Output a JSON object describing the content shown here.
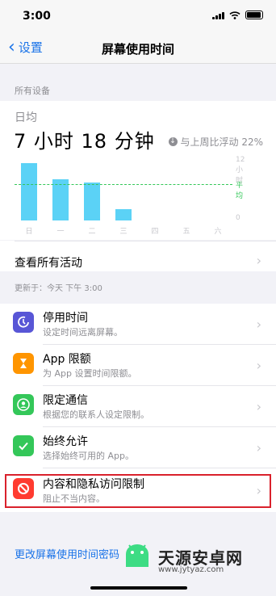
{
  "status_bar": {
    "time": "3:00"
  },
  "nav": {
    "back_label": "设置",
    "title": "屏幕使用时间"
  },
  "devices_header": "所有设备",
  "summary": {
    "avg_label": "日均",
    "avg_value": "7 小时 18 分钟",
    "compare_text": "与上周比浮动 22%"
  },
  "chart_data": {
    "type": "bar",
    "categories": [
      "日",
      "一",
      "二",
      "三",
      "四",
      "五",
      "六"
    ],
    "values": [
      11.5,
      8.3,
      7.6,
      2.2,
      0,
      0,
      0
    ],
    "ylim": [
      0,
      12
    ],
    "ytick_labels": [
      "12 小时",
      "0"
    ],
    "average_label": "平均",
    "average_value": 7.3,
    "bar_color": "#5bd2f6",
    "average_color": "#34c759"
  },
  "activity": {
    "label": "查看所有活动"
  },
  "updated_text": "更新于：今天 下午 3:00",
  "settings": [
    {
      "title": "停用时间",
      "subtitle": "设定时间远离屏幕。",
      "icon": "downtime-icon",
      "color": "#5856d6"
    },
    {
      "title": "App 限额",
      "subtitle": "为 App 设置时间限额。",
      "icon": "hourglass-icon",
      "color": "#ff9500"
    },
    {
      "title": "限定通信",
      "subtitle": "根据您的联系人设定限制。",
      "icon": "contact-icon",
      "color": "#34c759"
    },
    {
      "title": "始终允许",
      "subtitle": "选择始终可用的 App。",
      "icon": "checkmark-icon",
      "color": "#34c759"
    },
    {
      "title": "内容和隐私访问限制",
      "subtitle": "阻止不当内容。",
      "icon": "restriction-icon",
      "color": "#ff3b30"
    }
  ],
  "passcode_link": "更改屏幕使用时间密码",
  "watermark": {
    "text": "天源安卓网",
    "url": "www.jytyaz.com"
  }
}
